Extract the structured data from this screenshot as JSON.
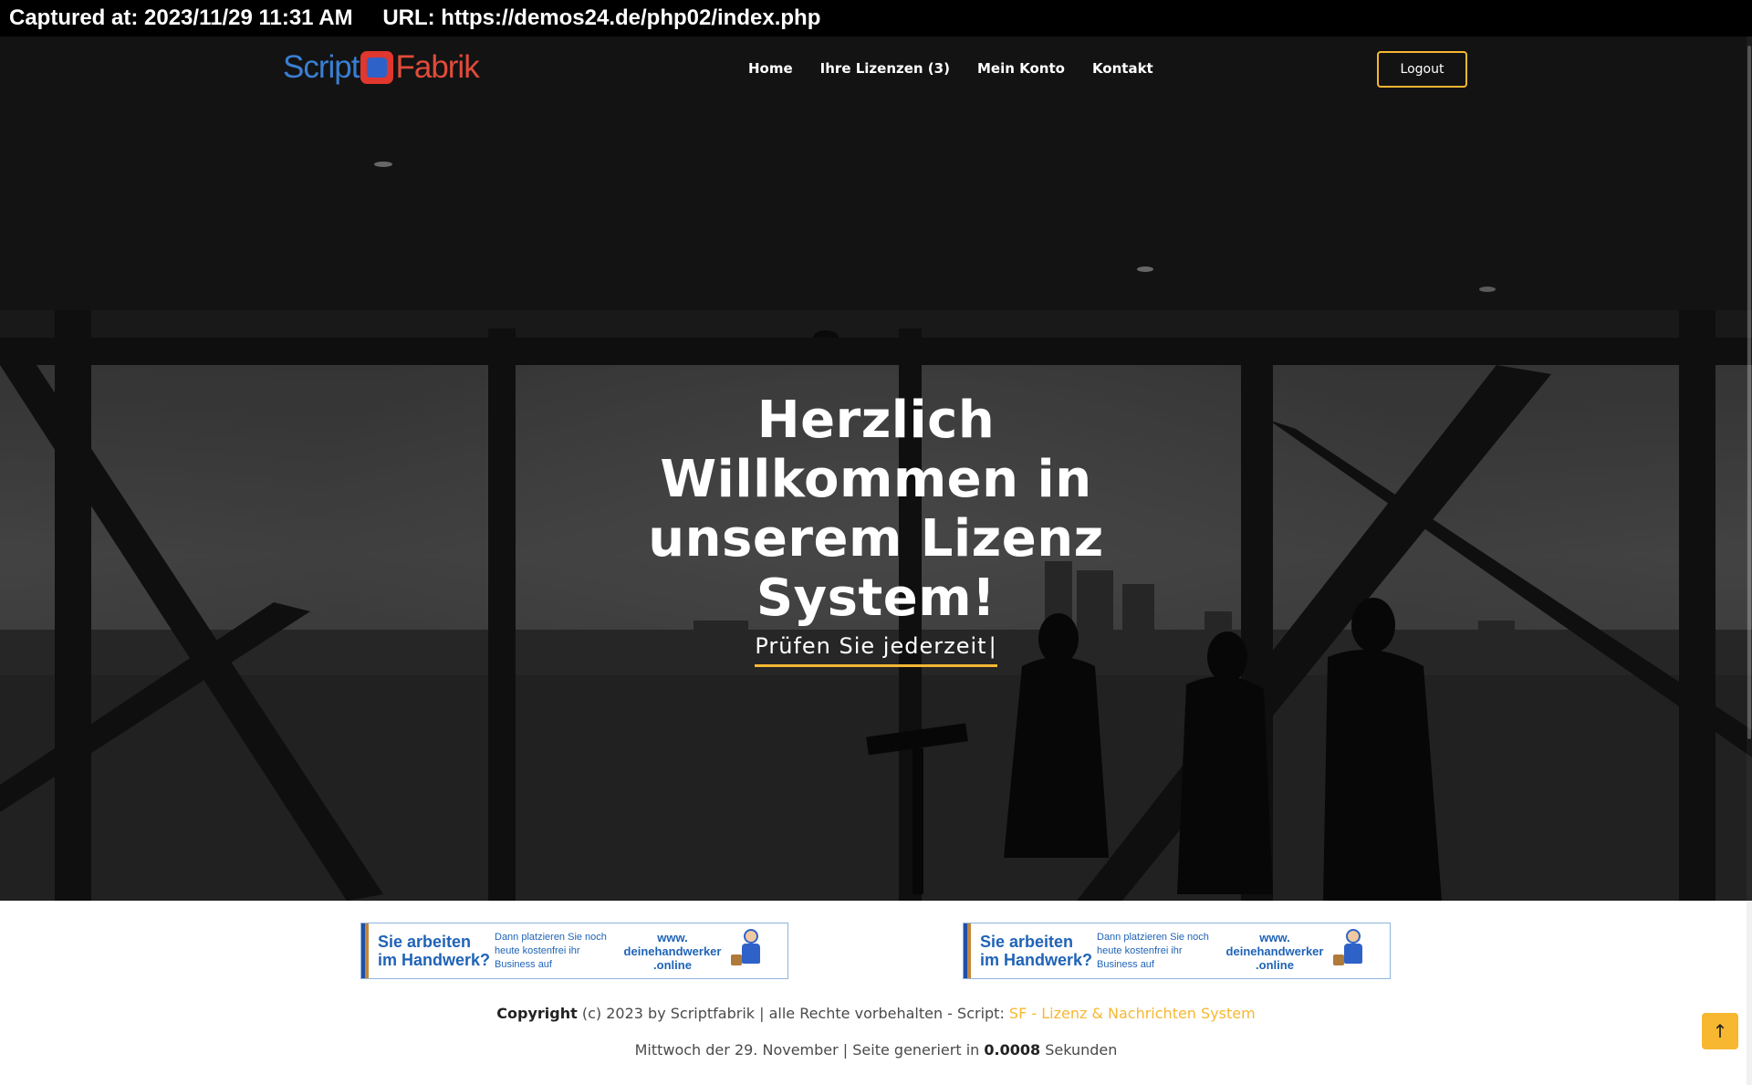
{
  "capture": {
    "captured_at": "Captured at: 2023/11/29 11:31 AM",
    "url": "URL: https://demos24.de/php02/index.php"
  },
  "header": {
    "logo_script": "Script",
    "logo_fabrik": "Fabrik",
    "nav": [
      {
        "label": "Home"
      },
      {
        "label": "Ihre Lizenzen (3)"
      },
      {
        "label": "Mein Konto"
      },
      {
        "label": "Kontakt"
      }
    ],
    "logout_label": "Logout"
  },
  "hero": {
    "title": "Herzlich Willkommen in unserem Lizenz System!",
    "typing_text": "Prüfen Sie jederzeit",
    "caret": "|"
  },
  "banners": [
    {
      "headline": "Sie arbeiten im Handwerk?",
      "subtext": "Dann platzieren Sie noch heute kostenfrei ihr Business auf",
      "url": "www. deinehandwerker .online"
    },
    {
      "headline": "Sie arbeiten im Handwerk?",
      "subtext": "Dann platzieren Sie noch heute kostenfrei ihr Business auf",
      "url": "www. deinehandwerker .online"
    }
  ],
  "footer": {
    "copyright_bold": "Copyright",
    "copyright_text": " (c) 2023 by Scriptfabrik | alle Rechte vorbehalten - Script: ",
    "script_link": "SF - Lizenz & Nachrichten System",
    "date_text": "Mittwoch der 29. November | Seite generiert in ",
    "gen_time": "0.0008",
    "seconds": " Sekunden"
  },
  "scroll_top_icon": "arrow-up-icon",
  "colors": {
    "accent": "#f7b731",
    "footer_text": "#4a4a4a",
    "banner_blue": "#1f63b7"
  }
}
